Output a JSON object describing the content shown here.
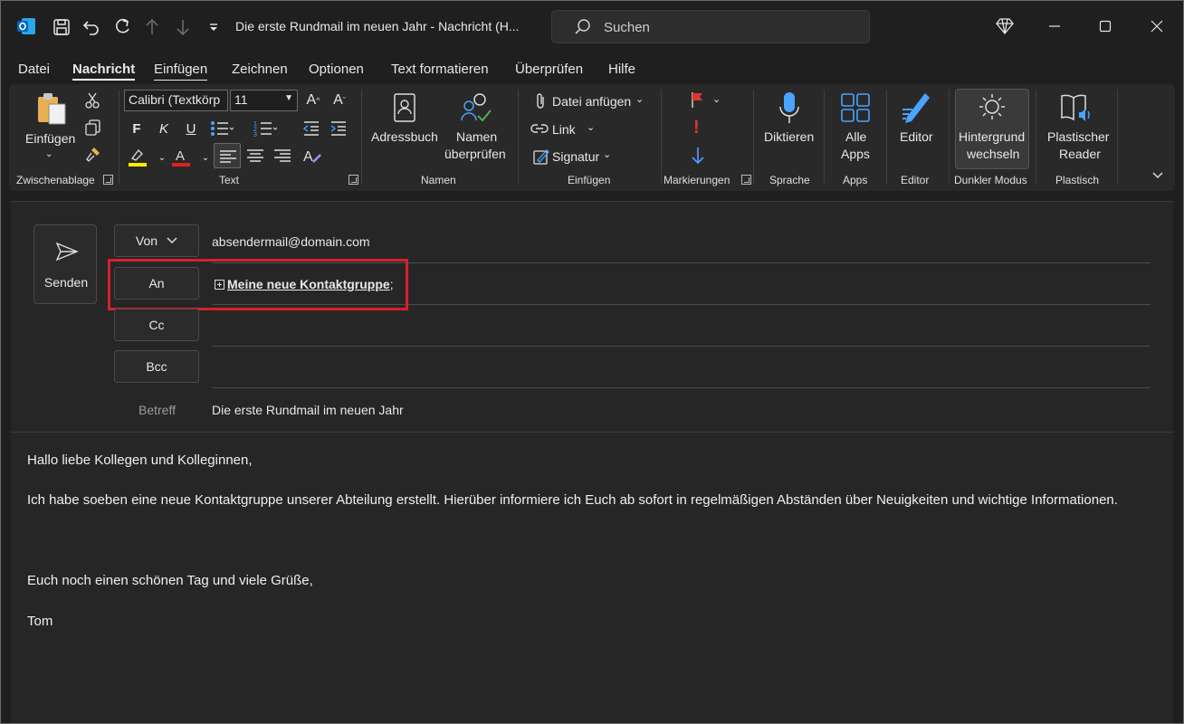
{
  "window": {
    "title": "Die erste Rundmail im neuen Jahr  -  Nachricht (H...",
    "search_placeholder": "Suchen"
  },
  "menu_tabs": [
    "Datei",
    "Nachricht",
    "Einfügen",
    "Zeichnen",
    "Optionen",
    "Text formatieren",
    "Überprüfen",
    "Hilfe"
  ],
  "ribbon": {
    "clipboard": {
      "paste": "Einfügen",
      "group": "Zwischenablage"
    },
    "text": {
      "font": "Calibri (Textkörp",
      "size": "11",
      "bold": "F",
      "italic": "K",
      "underline": "U",
      "group": "Text"
    },
    "names": {
      "address_book": "Adressbuch",
      "check_names_1": "Namen",
      "check_names_2": "überprüfen",
      "group": "Namen"
    },
    "insert": {
      "attach": "Datei anfügen",
      "link": "Link",
      "signature": "Signatur",
      "group": "Einfügen"
    },
    "tags": {
      "group": "Markierungen"
    },
    "voice": {
      "dictate": "Diktieren",
      "group": "Sprache"
    },
    "apps": {
      "all_apps_1": "Alle",
      "all_apps_2": "Apps",
      "group": "Apps"
    },
    "editor": {
      "editor": "Editor",
      "group": "Editor"
    },
    "dark_mode": {
      "switch_1": "Hintergrund",
      "switch_2": "wechseln",
      "group": "Dunkler Modus"
    },
    "immersive": {
      "reader_1": "Plastischer",
      "reader_2": "Reader",
      "group": "Plastisch"
    }
  },
  "compose": {
    "send": "Senden",
    "from_label": "Von",
    "from_value": "absendermail@domain.com",
    "to_label": "An",
    "to_value": "Meine neue Kontaktgruppe",
    "to_suffix": ";",
    "cc_label": "Cc",
    "bcc_label": "Bcc",
    "subject_label": "Betreff",
    "subject_value": "Die erste Rundmail im neuen Jahr"
  },
  "body": {
    "greeting": "Hallo liebe Kollegen und Kolleginnen,",
    "paragraph": "Ich habe soeben eine neue Kontaktgruppe unserer Abteilung erstellt. Hierüber informiere ich Euch ab sofort in regelmäßigen Abständen über Neuigkeiten und wichtige Informationen.",
    "closing": "Euch noch einen schönen Tag und viele Grüße,",
    "signature": "Tom"
  },
  "colors": {
    "highlight_annotation": "#d6202a",
    "flag": "#e3342f",
    "accent_blue": "#4aa3ff"
  }
}
